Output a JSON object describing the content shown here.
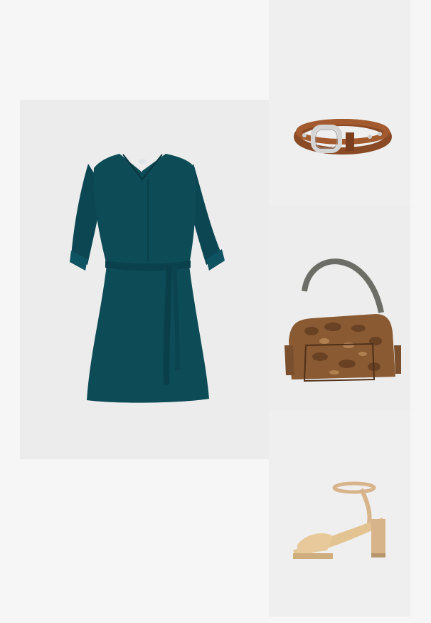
{
  "outfit": {
    "items": [
      {
        "id": "dress",
        "icon": "dress-image",
        "color": "#0c4a55"
      },
      {
        "id": "belt",
        "icon": "belt-image",
        "color": "#8a4a25"
      },
      {
        "id": "bag",
        "icon": "handbag-image",
        "color": "#7a4a26"
      },
      {
        "id": "sandals",
        "icon": "sandal-image",
        "color": "#e0bf8f"
      }
    ]
  },
  "colors": {
    "page_background": "#f6f6f6",
    "tile_background": "#ececec"
  }
}
